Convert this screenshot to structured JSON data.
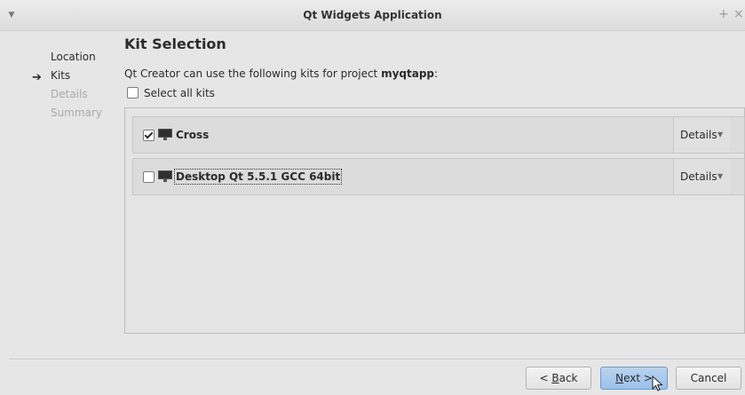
{
  "window": {
    "title": "Qt Widgets Application",
    "menu_icon": "chevron-down-icon",
    "pin_icon": "+",
    "close_icon": "×"
  },
  "nav": {
    "items": [
      {
        "label": "Location",
        "state": "done"
      },
      {
        "label": "Kits",
        "state": "current"
      },
      {
        "label": "Details",
        "state": "pending"
      },
      {
        "label": "Summary",
        "state": "pending"
      }
    ],
    "current_marker": "➔"
  },
  "page": {
    "heading": "Kit Selection",
    "description_prefix": "Qt Creator can use the following kits for project ",
    "project_name": "myqtapp",
    "description_suffix": ":",
    "select_all_label": "Select all kits",
    "select_all_checked": false
  },
  "kits": [
    {
      "name": "Cross",
      "checked": true,
      "details_label": "Details",
      "details_arrow": "▼"
    },
    {
      "name": "Desktop Qt 5.5.1 GCC 64bit",
      "checked": false,
      "details_label": "Details",
      "details_arrow": "▼"
    }
  ],
  "buttons": {
    "back": {
      "prefix": "< ",
      "underline": "B",
      "rest": "ack"
    },
    "next": {
      "underline": "N",
      "rest": "ext >"
    },
    "cancel": "Cancel"
  },
  "colors": {
    "accent": "#9cc0ea",
    "background": "#e6e6e6"
  }
}
